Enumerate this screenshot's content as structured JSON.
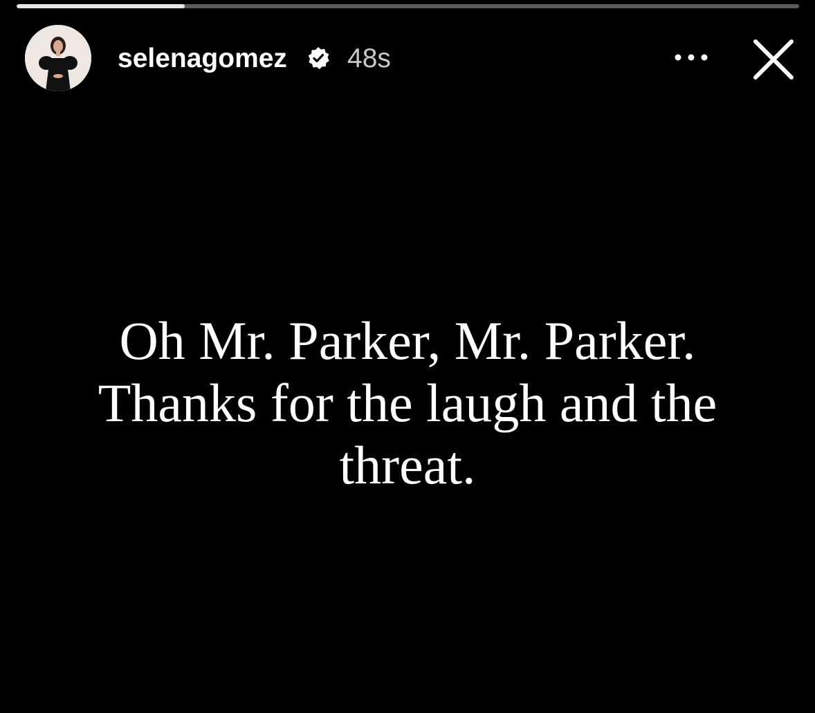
{
  "story": {
    "progress": 0.215,
    "colors": {
      "background": "#000000",
      "progress_track": "#5a5a5a",
      "progress_fill": "#e6e6e6",
      "text": "#ffffff",
      "meta_text": "#c9c9c9"
    }
  },
  "header": {
    "username": "selenagomez",
    "verified_icon": "verified-badge-icon",
    "time_ago": "48s",
    "more_icon": "more-horizontal-icon",
    "close_icon": "close-icon"
  },
  "content": {
    "lines": [
      "Oh Mr. Parker, Mr. Parker.",
      "Thanks for the laugh and the",
      "threat."
    ]
  }
}
